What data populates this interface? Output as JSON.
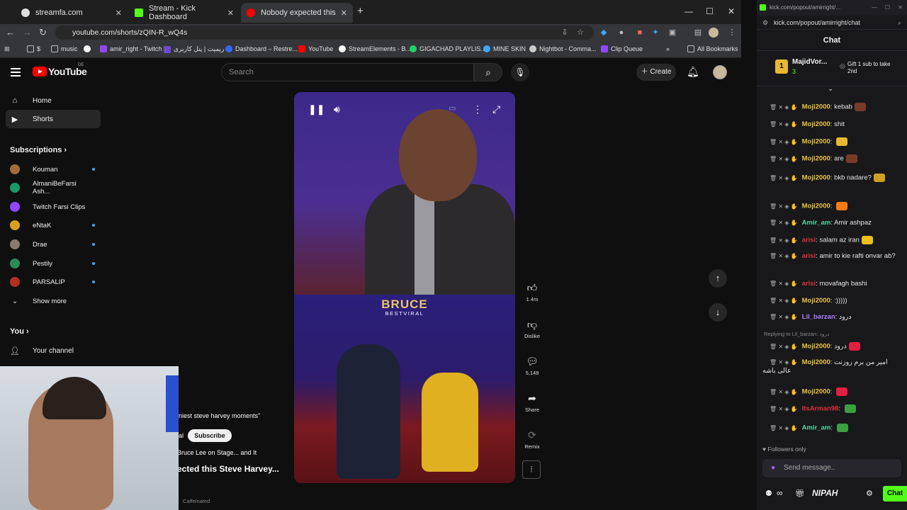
{
  "browser": {
    "tabs": [
      {
        "label": "streamfa.com",
        "color": "#ffffff"
      },
      {
        "label": "Stream - Kick Dashboard",
        "color": "#53fc18"
      },
      {
        "label": "Nobody expected this Steve",
        "color": "#ff0000"
      }
    ],
    "url": "youtube.com/shorts/zQIN-R_wQ4s",
    "bookmarks": [
      {
        "label": "$",
        "color": "#cfcfcf"
      },
      {
        "label": "music",
        "color": "#cfcfcf"
      },
      {
        "label": "amir_right - Twitch",
        "color": "#9146ff"
      },
      {
        "label": "ریمیت | پنل کاربری",
        "color": "#6b4ccf"
      },
      {
        "label": "Dashboard – Restre...",
        "color": "#2f6bff"
      },
      {
        "label": "YouTube",
        "color": "#ff0000"
      },
      {
        "label": "StreamElements - B...",
        "color": "#ffffff"
      },
      {
        "label": "GIGACHAD PLAYLIS...",
        "color": "#1ed760"
      },
      {
        "label": "MINE SKIN",
        "color": "#3ea6ff"
      },
      {
        "label": "Nightbot - Comma...",
        "color": "#cccccc"
      },
      {
        "label": "Clip Queue",
        "color": "#9146ff"
      }
    ],
    "all_bookmarks": "All Bookmarks"
  },
  "youtube": {
    "logo_text": "YouTube",
    "country": "DE",
    "search_placeholder": "Search",
    "create_label": "Create",
    "sidebar": {
      "home": "Home",
      "shorts": "Shorts",
      "subscriptions": "Subscriptions",
      "subs": [
        {
          "name": "Kouman",
          "color": "#a56b3a",
          "live": true
        },
        {
          "name": "AlmaniBeFarsi Ash...",
          "color": "#1a9a6a",
          "live": false
        },
        {
          "name": "Twitch Farsi Clips",
          "color": "#9146ff",
          "live": false
        },
        {
          "name": "eNtaK",
          "color": "#d9a020",
          "live": true
        },
        {
          "name": "Drae",
          "color": "#8a7a6a",
          "live": true
        },
        {
          "name": "Pestily",
          "color": "#2a8a5a",
          "live": true
        },
        {
          "name": "PARSALIP",
          "color": "#b03020",
          "live": true
        }
      ],
      "show_more": "Show more",
      "you": "You",
      "your_channel": "Your channel"
    },
    "video": {
      "overlay_title": "BRUCE",
      "overlay_sub": "BESTVIRAL",
      "caption": "niest steve harvey moments\"",
      "channel_frag": "al",
      "subscribe": "Subscribe",
      "desc": "Bruce Lee on Stage... and It",
      "title": "ected this Steve Harvey...",
      "footer": "Caffeinated"
    },
    "actions": {
      "likes": "1.4m",
      "dislike": "Dislike",
      "comments": "5,148",
      "share": "Share",
      "remix": "Remix"
    }
  },
  "chat": {
    "window_url_short": "kick.com/popout/amirright/...",
    "url": "kick.com/popout/amirright/chat",
    "header": "Chat",
    "pinned_user": "MajidVor...",
    "pinned_count": "3",
    "gift_text": "Gift 1 sub to take 2nd",
    "messages": [
      {
        "user": "Moji2000",
        "color": "#e8c43a",
        "text": "kebab",
        "emote": "#7a3a2a"
      },
      {
        "user": "Moji2000",
        "color": "#e8c43a",
        "text": "shit",
        "emote": ""
      },
      {
        "user": "Moji2000",
        "color": "#e8c43a",
        "text": "",
        "emote": "#e8b830"
      },
      {
        "user": "Moji2000",
        "color": "#e8c43a",
        "text": "are",
        "emote": "#7a3a2a"
      },
      {
        "user": "Moji2000",
        "color": "#e8c43a",
        "text": "bkb nadare?",
        "emote": "#d0a020"
      },
      {
        "user": "Moji2000",
        "color": "#e8c43a",
        "text": "",
        "emote": "#ff7a10"
      },
      {
        "user": "Amir_am",
        "color": "#53d9a0",
        "text": "Amir ashpaz",
        "emote": ""
      },
      {
        "user": "arisi",
        "color": "#e0303a",
        "text": "salam az iran",
        "emote": "#e8c020"
      },
      {
        "user": "arisi",
        "color": "#e0303a",
        "text": "amir to kie rafti onvar ab?",
        "emote": ""
      },
      {
        "user": "arisi",
        "color": "#e0303a",
        "text": "movafagh bashi",
        "emote": ""
      },
      {
        "user": "Moji2000",
        "color": "#e8c43a",
        "text": ":)))))",
        "emote": ""
      },
      {
        "user": "Lil_barzan",
        "color": "#b07cff",
        "text": "درود",
        "emote": ""
      },
      {
        "user": "Moji2000",
        "color": "#e8c43a",
        "text": "درود",
        "emote": "#e02040"
      },
      {
        "user": "Moji2000",
        "color": "#e8c43a",
        "text": "امیر من برم روزنت عالی باشه",
        "emote": ""
      },
      {
        "user": "Moji2000",
        "color": "#e8c43a",
        "text": "",
        "emote": "#e02040"
      },
      {
        "user": "ItsArman98",
        "color": "#e0303a",
        "text": "",
        "emote": "#3aa040"
      },
      {
        "user": "Amir_am",
        "color": "#53d9a0",
        "text": "",
        "emote": "#3aa040"
      }
    ],
    "reply_note": "Replying to Lil_barzan: درود",
    "followers_only": "Followers only",
    "send_placeholder": "Send message..",
    "chat_btn": "Chat",
    "nipah": "NIPAH"
  }
}
